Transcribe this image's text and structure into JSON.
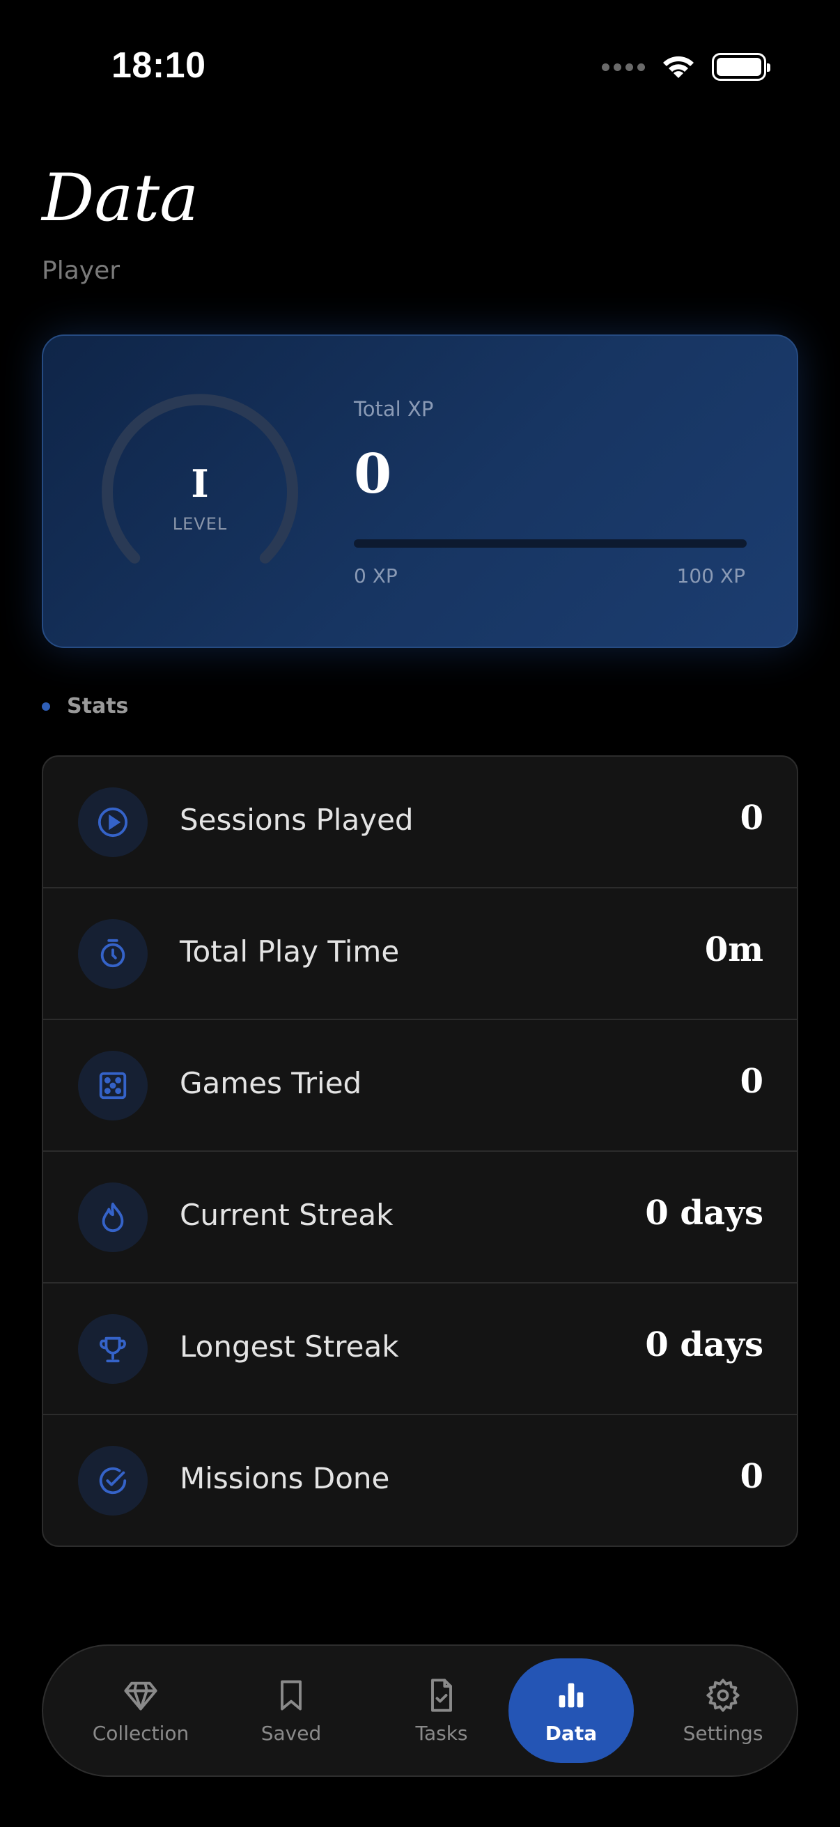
{
  "status_bar": {
    "time": "18:10",
    "icons": [
      "cellular-signal-icon",
      "wifi-icon",
      "battery-icon"
    ]
  },
  "header": {
    "title": "Data",
    "subtitle": "Player"
  },
  "level_card": {
    "level": "I",
    "level_label": "LEVEL",
    "xp_label": "Total XP",
    "xp_value": "0",
    "xp_progress_fraction": 0,
    "xp_min": "0 XP",
    "xp_max": "100 XP"
  },
  "stats": {
    "section_title": "Stats",
    "rows": [
      {
        "icon": "play-circle-icon",
        "label": "Sessions Played",
        "value": "0"
      },
      {
        "icon": "stopwatch-icon",
        "label": "Total Play Time",
        "value": "0m"
      },
      {
        "icon": "dice-icon",
        "label": "Games Tried",
        "value": "0"
      },
      {
        "icon": "flame-icon",
        "label": "Current Streak",
        "value": "0 days"
      },
      {
        "icon": "trophy-icon",
        "label": "Longest Streak",
        "value": "0 days"
      },
      {
        "icon": "check-circle-icon",
        "label": "Missions Done",
        "value": "0"
      }
    ]
  },
  "nav": {
    "items": [
      {
        "icon": "gem-icon",
        "label": "Collection",
        "active": false
      },
      {
        "icon": "bookmark-icon",
        "label": "Saved",
        "active": false
      },
      {
        "icon": "file-check-icon",
        "label": "Tasks",
        "active": false
      },
      {
        "icon": "bar-chart-icon",
        "label": "Data",
        "active": true
      },
      {
        "icon": "gear-icon",
        "label": "Settings",
        "active": false
      }
    ]
  },
  "colors": {
    "accent": "#2455b5",
    "icon_blue": "#3563c9",
    "card_gradient_start": "#0f2548",
    "card_gradient_end": "#1c3d70",
    "background": "#000000"
  }
}
